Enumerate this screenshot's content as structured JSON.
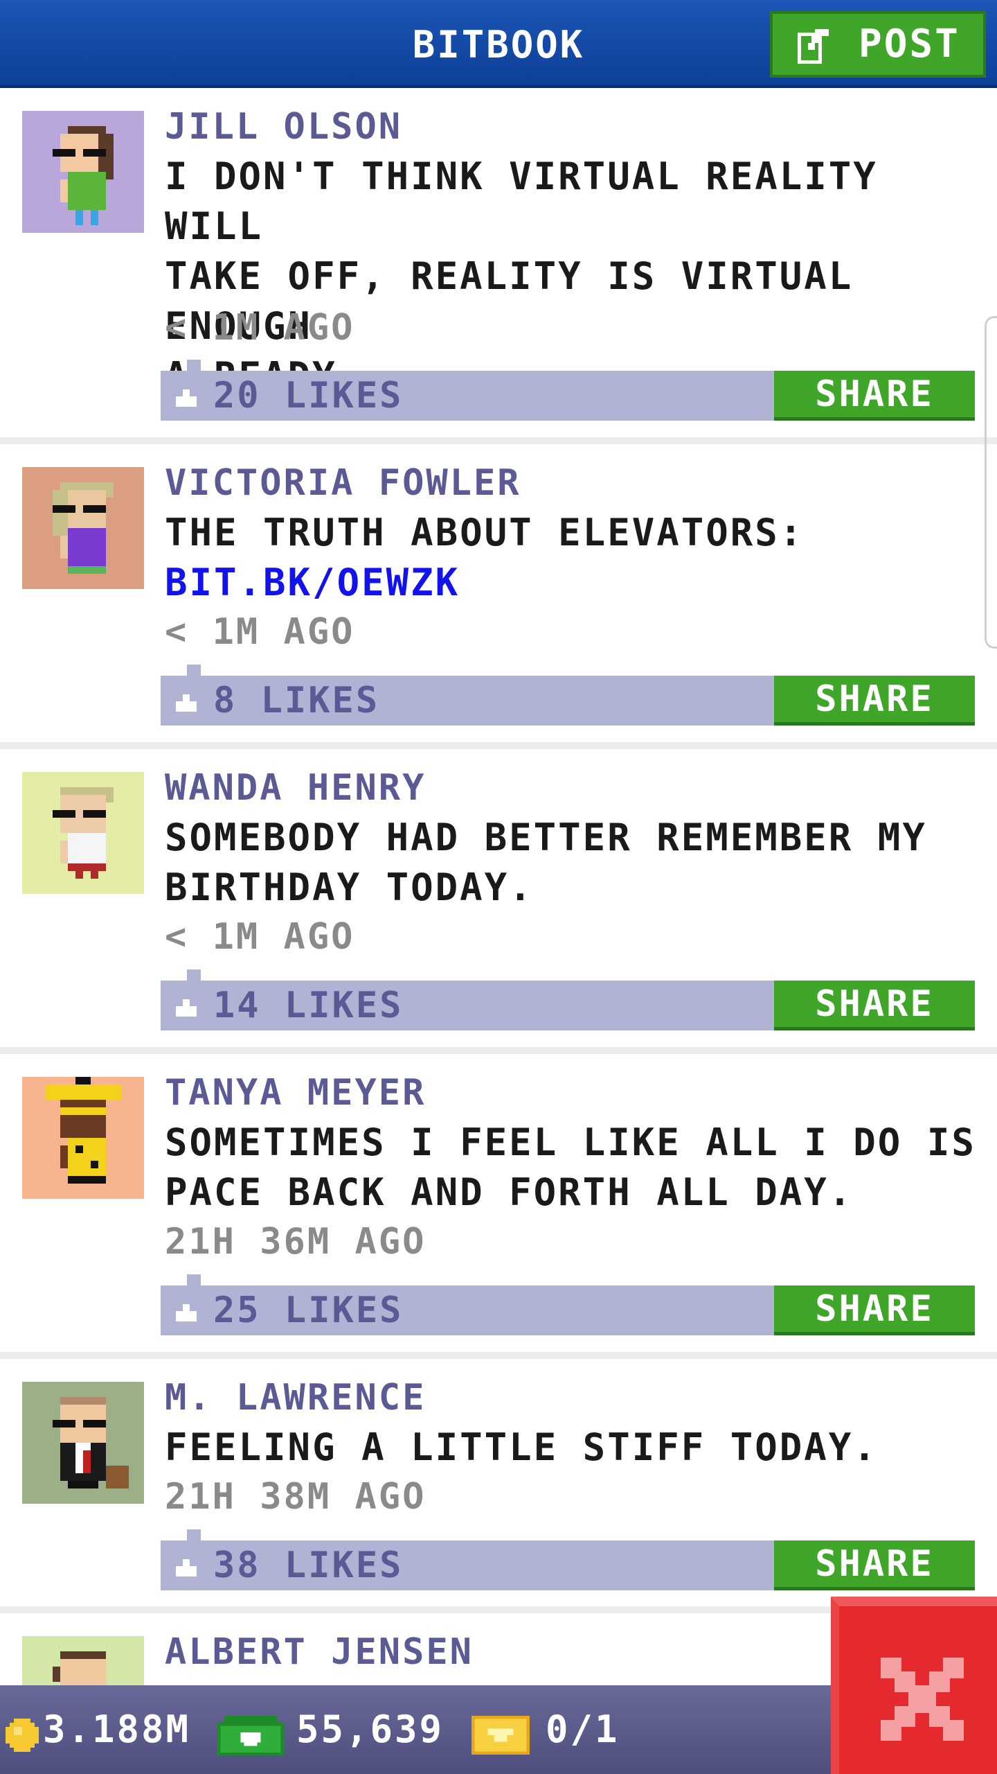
{
  "header": {
    "title": "BITBOOK",
    "post_label": "POST"
  },
  "posts": [
    {
      "author": "JILL OLSON",
      "text": "I DON'T THINK VIRTUAL REALITY WILL\nTAKE OFF, REALITY IS VIRTUAL ENOUGH\nALREADY.",
      "link": "",
      "time": "< 1M AGO",
      "likes": "20 LIKES",
      "share": "SHARE",
      "avatar_bg": "#b9a7dc"
    },
    {
      "author": "VICTORIA FOWLER",
      "text": "THE TRUTH ABOUT ELEVATORS:",
      "link": "BIT.BK/OEWZK",
      "time": "< 1M AGO",
      "likes": "8 LIKES",
      "share": "SHARE",
      "avatar_bg": "#dc9e80"
    },
    {
      "author": "WANDA HENRY",
      "text": "SOMEBODY HAD BETTER REMEMBER MY\nBIRTHDAY TODAY.",
      "link": "",
      "time": "< 1M AGO",
      "likes": "14 LIKES",
      "share": "SHARE",
      "avatar_bg": "#e5eca5"
    },
    {
      "author": "TANYA MEYER",
      "text": "SOMETIMES I FEEL LIKE ALL I DO IS\nPACE BACK AND FORTH ALL DAY.",
      "link": "",
      "time": "21H 36M AGO",
      "likes": "25 LIKES",
      "share": "SHARE",
      "avatar_bg": "#f7b48e"
    },
    {
      "author": "M. LAWRENCE",
      "text": "FEELING A LITTLE STIFF TODAY.",
      "link": "",
      "time": "21H 38M AGO",
      "likes": "38 LIKES",
      "share": "SHARE",
      "avatar_bg": "#9caf86"
    },
    {
      "author": "ALBERT JENSEN",
      "text": "",
      "link": "",
      "time": "",
      "likes": "",
      "share": "",
      "avatar_bg": "#d4e7a8"
    }
  ],
  "status": {
    "coins": "3.188M",
    "cash": "55,639",
    "tickets": "0/1"
  },
  "colors": {
    "header_blue": "#1c56b6",
    "share_green": "#3fa62a",
    "likes_bar": "#b1b3d4",
    "author_purple": "#5c5a94",
    "close_red": "#e42a2e"
  },
  "icons": [
    "edit-icon",
    "thumbs-up-icon",
    "coin-icon",
    "cash-icon",
    "ticket-icon",
    "close-icon"
  ]
}
